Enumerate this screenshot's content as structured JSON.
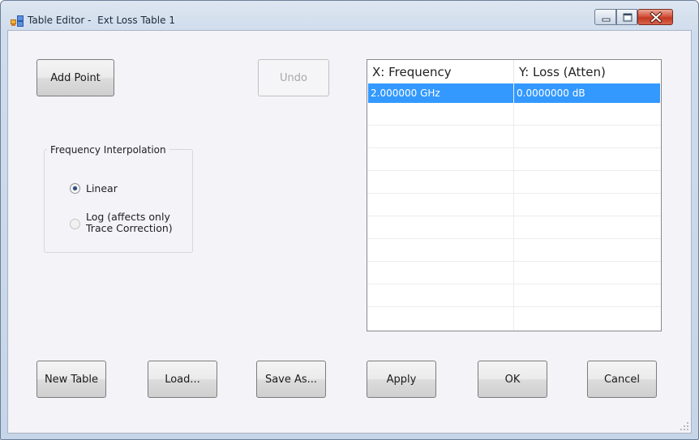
{
  "window": {
    "title": "Table Editor -  Ext Loss Table 1",
    "icons": {
      "app": "table-editor-icon",
      "minimize": "minimize-icon",
      "maximize": "maximize-icon",
      "close": "close-icon"
    }
  },
  "toolbar": {
    "add_point": "Add Point",
    "undo": "Undo"
  },
  "interpolation": {
    "group_label": "Frequency Interpolation",
    "options": [
      {
        "label": "Linear",
        "checked": true
      },
      {
        "label": "Log (affects only\nTrace Correction)",
        "checked": false
      }
    ]
  },
  "table": {
    "columns": [
      "X: Frequency",
      "Y: Loss (Atten)"
    ],
    "rows": [
      {
        "x": "2.000000 GHz",
        "y": "0.0000000 dB",
        "selected": true
      }
    ]
  },
  "buttons": {
    "new_table": "New Table",
    "load": "Load...",
    "save_as": "Save As...",
    "apply": "Apply",
    "ok": "OK",
    "cancel": "Cancel"
  },
  "colors": {
    "selection": "#3399ff",
    "client_bg": "#f3f3f8",
    "close_button": "#c23a22"
  }
}
